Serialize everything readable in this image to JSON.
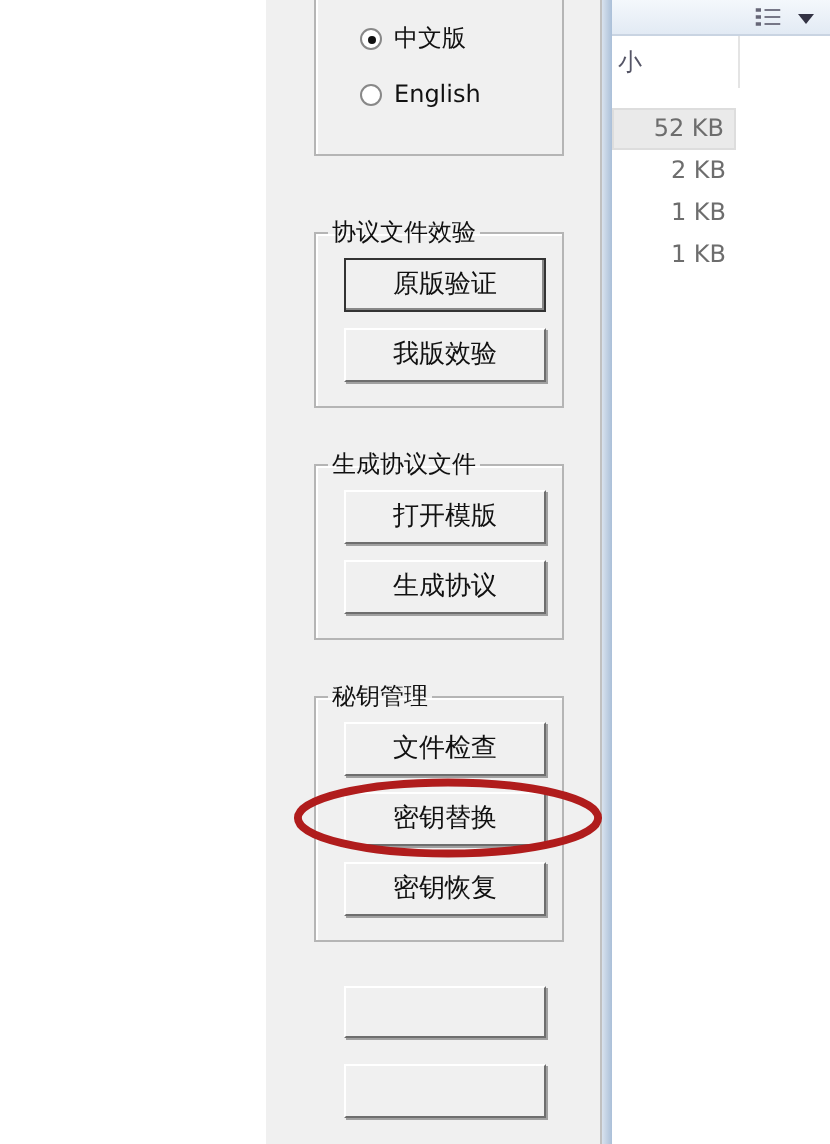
{
  "language": {
    "options": [
      {
        "label": "中文版",
        "selected": true
      },
      {
        "label": "English",
        "selected": false
      }
    ]
  },
  "groups": [
    {
      "title": "协议文件效验",
      "buttons": [
        {
          "label": "原版验证",
          "circled": false,
          "focused": true
        },
        {
          "label": "我版效验",
          "circled": false,
          "focused": false
        }
      ]
    },
    {
      "title": "生成协议文件",
      "buttons": [
        {
          "label": "打开模版",
          "circled": false,
          "focused": false
        },
        {
          "label": "生成协议",
          "circled": false,
          "focused": false
        }
      ]
    },
    {
      "title": "秘钥管理",
      "buttons": [
        {
          "label": "文件检查",
          "circled": false,
          "focused": false
        },
        {
          "label": "密钥替换",
          "circled": true,
          "focused": false
        },
        {
          "label": "密钥恢复",
          "circled": false,
          "focused": false
        }
      ]
    }
  ],
  "file_list": {
    "column": "小",
    "rows": [
      {
        "size": "52 KB",
        "selected": true
      },
      {
        "size": "2 KB",
        "selected": false
      },
      {
        "size": "1 KB",
        "selected": false
      },
      {
        "size": "1 KB",
        "selected": false
      }
    ]
  }
}
